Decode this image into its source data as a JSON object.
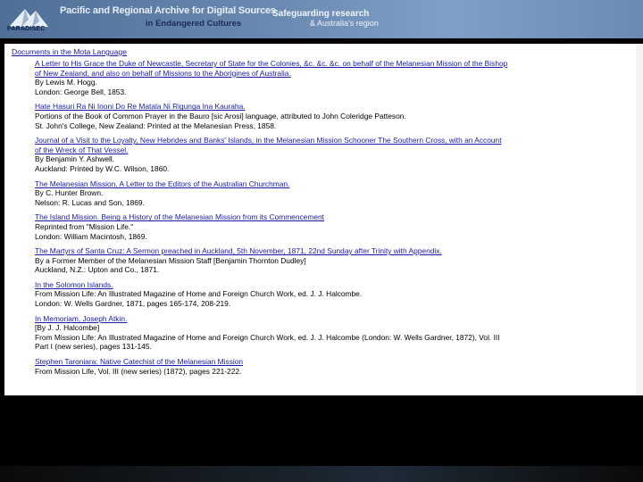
{
  "banner": {
    "logo_label": "PARADISEC",
    "title": "Pacific and Regional Archive for Digital Sources",
    "subtitle": "in Endangered Cultures",
    "tagline_1": "Safeguarding research",
    "tagline_2": "& Australia's region"
  },
  "page": {
    "heading": "Documents in the Mota Language",
    "entries": [
      {
        "title_1": "A Letter to His Grace the Duke of Newcastle, Secretary of State for the Colonies, &c. &c. &c. on behalf of the Melanesian Mission of the Bishop",
        "title_2": "of New Zealand, and also on behalf of Missions to the Aborigines of Australia.",
        "line_1": "By Lewis M. Hogg.",
        "line_2": "London: George Bell, 1853."
      },
      {
        "title_1": "Hate Hasuri Ra Ni Inoni Do Re Matala Ni Rigunga Ina Kauraha.",
        "line_1": "Portions of the Book of Common Prayer in the Bauro [sic Arosi] language, attributed to John Coleridge Patteson.",
        "line_2": "St. John's College, New Zealand: Printed at the Melanesian Press, 1858."
      },
      {
        "title_1": "Journal of a Visit to the Loyalty, New Hebrides and Banks' Islands, in the Melanesian Mission Schooner The Southern Cross, with an Account",
        "title_2": "of the Wreck of That Vessel.",
        "line_1": "By Benjamin Y. Ashwell.",
        "line_2": "Auckland: Printed by W.C. Wilson, 1860."
      },
      {
        "title_1": "The Melanesian Mission. A Letter to the Editors of the Australian Churchman.",
        "line_1": "By C. Hunter Brown.",
        "line_2": "Nelson: R. Lucas and Son, 1869."
      },
      {
        "title_1": "The Island Mission. Being a History of the Melanesian Mission from its Commencement",
        "line_1": "Reprinted from \"Mission Life.\"",
        "line_2": "London: William Macintosh, 1869."
      },
      {
        "title_1": "The Martyrs of Santa Cruz: A Sermon preached in Auckland, 5th November, 1871, 22nd Sunday after Trinity with Appendix.",
        "line_1": "By a Former Member of the Melanesian Mission Staff [Benjamin Thornton Dudley]",
        "line_2": "Auckland, N.Z.: Upton and Co., 1871."
      },
      {
        "title_1": "In the Solomon Islands.",
        "line_1": "From Mission Life: An Illustrated Magazine of Home and Foreign Church Work, ed. J. J. Halcombe.",
        "line_2": "London: W. Wells Gardner, 1871, pages 165-174, 208-219."
      },
      {
        "title_1": "In Memoriam, Joseph Atkin.",
        "line_1": "[By J. J. Halcombe]",
        "line_2": "From Mission Life: An Illustrated Magazine of Home and Foreign Church Work, ed. J. J. Halcombe (London: W. Wells Gardner, 1872), Vol. III",
        "line_3": "Part I (new series), pages 131-145."
      },
      {
        "title_1": "Stephen Taroniara: Native Catechist of the Melanesian Mission",
        "line_1": "From Mission Life, Vol. III (new series) (1872), pages 221-222."
      }
    ]
  },
  "colors": {
    "link": "#1a1aa6",
    "banner": "#6b8bb3",
    "background": "#000000"
  }
}
